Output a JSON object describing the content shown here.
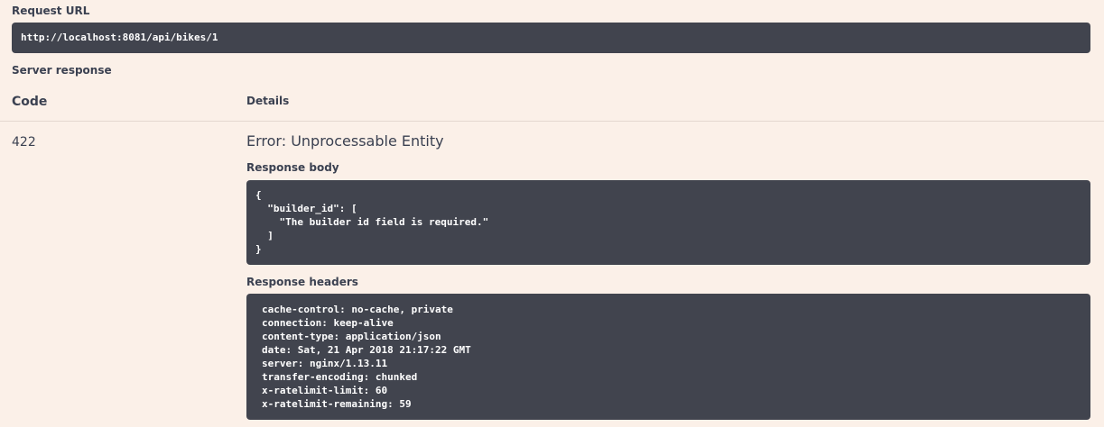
{
  "request_url": {
    "label": "Request URL",
    "value": "http://localhost:8081/api/bikes/1"
  },
  "server_response": {
    "label": "Server response",
    "columns": {
      "code": "Code",
      "details": "Details"
    },
    "code": "422",
    "error_title": "Error: Unprocessable Entity",
    "response_body": {
      "label": "Response body",
      "lines": [
        "{",
        "  \"builder_id\": [",
        "    \"The builder id field is required.\"",
        "  ]",
        "}"
      ]
    },
    "response_headers": {
      "label": "Response headers",
      "lines": [
        "cache-control: no-cache, private",
        "connection: keep-alive",
        "content-type: application/json",
        "date: Sat, 21 Apr 2018 21:17:22 GMT",
        "server: nginx/1.13.11",
        "transfer-encoding: chunked",
        "x-ratelimit-limit: 60",
        "x-ratelimit-remaining: 59"
      ]
    }
  },
  "colors": {
    "background": "#fbf0e8",
    "code_block": "#41444e",
    "text": "#3b4151"
  }
}
